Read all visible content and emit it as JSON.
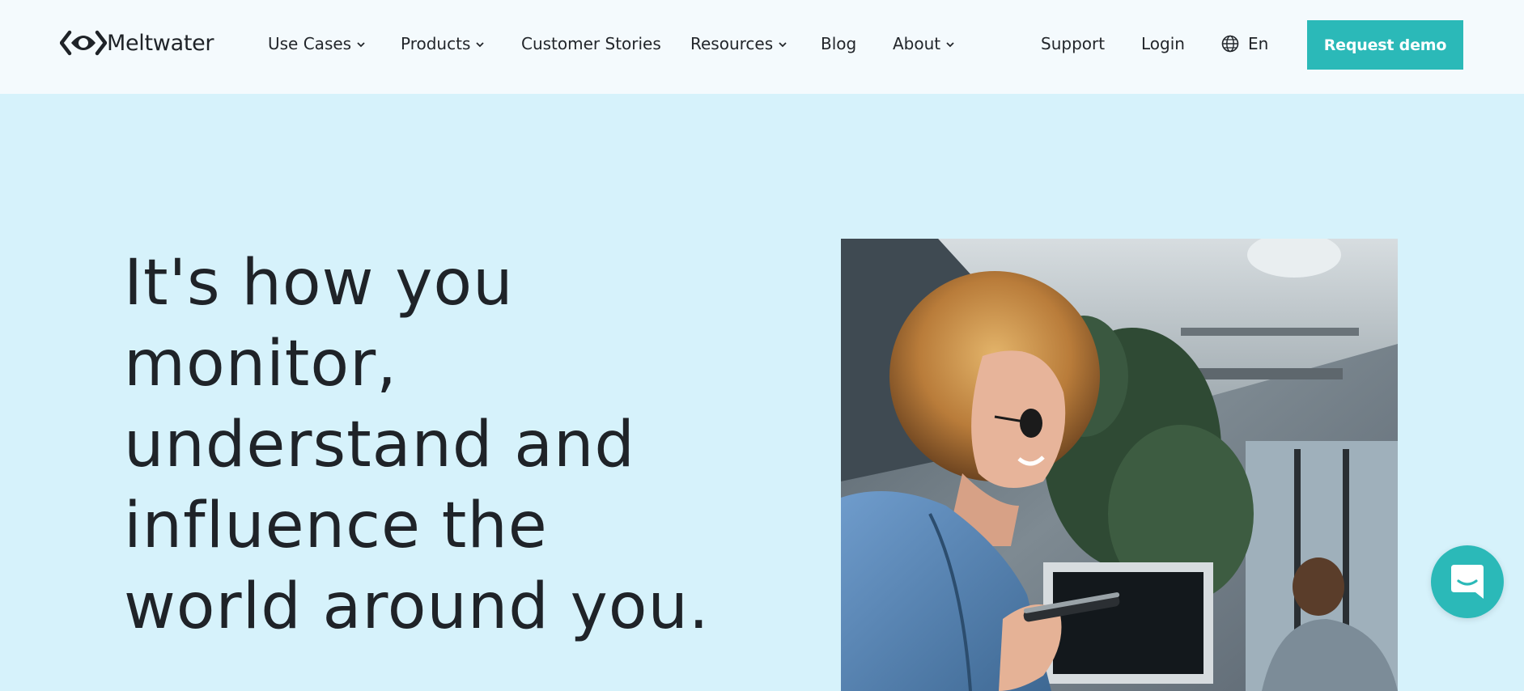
{
  "brand": {
    "name": "Meltwater",
    "logo_icon": "meltwater-eye-logo-icon"
  },
  "nav": {
    "items": [
      {
        "label": "Use Cases",
        "has_dropdown": true
      },
      {
        "label": "Products",
        "has_dropdown": true
      },
      {
        "label": "Customer Stories",
        "has_dropdown": false
      },
      {
        "label": "Resources",
        "has_dropdown": true
      },
      {
        "label": "Blog",
        "has_dropdown": false
      },
      {
        "label": "About",
        "has_dropdown": true
      }
    ],
    "support_label": "Support",
    "login_label": "Login",
    "language_label": "En",
    "language_icon": "globe-icon",
    "cta_label": "Request demo"
  },
  "hero": {
    "headline_lines": [
      "It's how you",
      "monitor,",
      "understand and",
      "influence the",
      "world around you."
    ],
    "image_icon": "woman-smiling-at-phone-photo"
  },
  "chat": {
    "icon": "chat-bubble-icon"
  },
  "colors": {
    "accent": "#2bb9b8",
    "header_bg": "#f4fafd",
    "hero_bg": "#d6f2fb",
    "text": "#1f2328"
  }
}
